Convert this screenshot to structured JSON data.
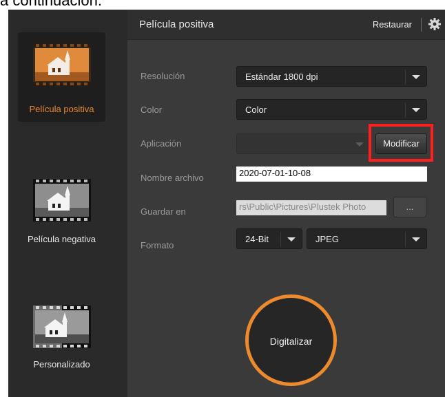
{
  "caption": "a continuación:",
  "sidebar": {
    "items": [
      {
        "label": "Película positiva",
        "icon": "positive-film-icon",
        "active": true
      },
      {
        "label": "Película negativa",
        "icon": "negative-film-icon",
        "active": false
      },
      {
        "label": "Personalizado",
        "icon": "custom-film-icon",
        "active": false
      }
    ]
  },
  "header": {
    "title": "Película positiva",
    "restore_label": "Restaurar",
    "settings_icon": "gear-icon"
  },
  "form": {
    "resolution": {
      "label": "Resolución",
      "value": "Estándar 1800 dpi"
    },
    "color": {
      "label": "Color",
      "value": "Color"
    },
    "application": {
      "label": "Aplicación",
      "value": "",
      "button": "Modificar"
    },
    "filename": {
      "label": "Nombre archivo",
      "value": "2020-07-01-10-08"
    },
    "save_in": {
      "label": "Guardar en",
      "value": "rs\\Public\\Pictures\\Plustek Photo",
      "browse": "..."
    },
    "format": {
      "label": "Formato",
      "bit_depth": "24-Bit",
      "file_type": "JPEG"
    }
  },
  "scan_button": {
    "label": "Digitalizar"
  },
  "colors": {
    "accent": "#ec8a2d",
    "highlight": "#ff1f1f",
    "panel": "#3a3a3a",
    "sidebar": "#2a2a2a"
  }
}
